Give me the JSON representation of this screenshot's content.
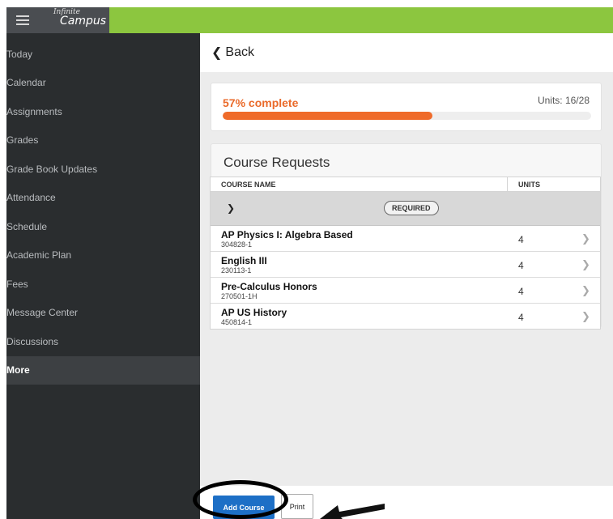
{
  "header": {
    "logo_line1": "Infinite",
    "logo_line2": "Campus"
  },
  "sidebar": {
    "items": [
      {
        "label": "Today"
      },
      {
        "label": "Calendar"
      },
      {
        "label": "Assignments"
      },
      {
        "label": "Grades"
      },
      {
        "label": "Grade Book Updates"
      },
      {
        "label": "Attendance"
      },
      {
        "label": "Schedule"
      },
      {
        "label": "Academic Plan"
      },
      {
        "label": "Fees"
      },
      {
        "label": "Message Center"
      },
      {
        "label": "Discussions"
      },
      {
        "label": "More"
      }
    ],
    "active": "More"
  },
  "main": {
    "back_label": "Back",
    "progress": {
      "label": "57% complete",
      "units": "Units: 16/28",
      "fraction": 0.57
    },
    "requests": {
      "title": "Course Requests",
      "columns": [
        "COURSE NAME",
        "UNITS"
      ],
      "group_badge": "REQUIRED",
      "courses": [
        {
          "name": "AP Physics I: Algebra Based",
          "code": "304828-1",
          "units": "4"
        },
        {
          "name": "English III",
          "code": "230113-1",
          "units": "4"
        },
        {
          "name": "Pre-Calculus Honors",
          "code": "270501-1H",
          "units": "4"
        },
        {
          "name": "AP US History",
          "code": "450814-1",
          "units": "4"
        }
      ]
    }
  },
  "footer": {
    "add_label": "Add Course",
    "print_label": "Print"
  },
  "colors": {
    "topbar": "#8cc63f",
    "sidebar": "#2a2d2f",
    "progress": "#ef6b2a",
    "primary_button": "#1d6fc6"
  }
}
